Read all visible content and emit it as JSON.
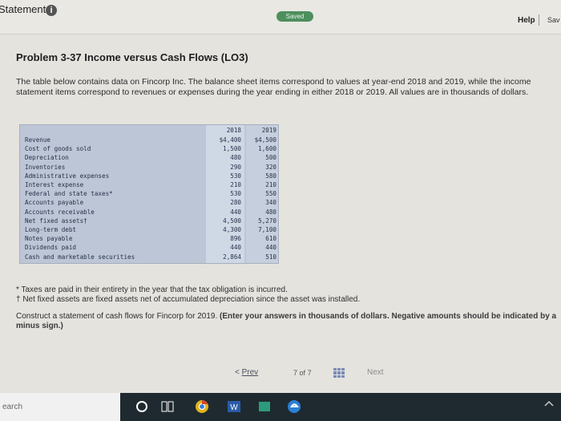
{
  "header": {
    "statement_label": "Statement",
    "info_icon": "i",
    "saved_label": "Saved",
    "help_label": "Help",
    "save_label": "Sav"
  },
  "problem": {
    "title": "Problem 3-37 Income versus Cash Flows (LO3)",
    "intro": "The table below contains data on Fincorp Inc. The balance sheet items correspond to values at year-end 2018 and 2019, while the income statement items correspond to revenues or expenses during the year ending in either 2018 or 2019. All values are in thousands of dollars."
  },
  "table": {
    "year_2018": "2018",
    "year_2019": "2019",
    "rows": [
      {
        "label": "Revenue",
        "v2018": "$4,400",
        "v2019": "$4,500"
      },
      {
        "label": "Cost of goods sold",
        "v2018": "1,500",
        "v2019": "1,600"
      },
      {
        "label": "Depreciation",
        "v2018": "480",
        "v2019": "500"
      },
      {
        "label": "Inventories",
        "v2018": "290",
        "v2019": "320"
      },
      {
        "label": "Administrative expenses",
        "v2018": "530",
        "v2019": "580"
      },
      {
        "label": "Interest expense",
        "v2018": "210",
        "v2019": "210"
      },
      {
        "label": "Federal and state taxes*",
        "v2018": "530",
        "v2019": "550"
      },
      {
        "label": "Accounts payable",
        "v2018": "280",
        "v2019": "340"
      },
      {
        "label": "Accounts receivable",
        "v2018": "440",
        "v2019": "480"
      },
      {
        "label": "Net fixed assets†",
        "v2018": "4,500",
        "v2019": "5,270"
      },
      {
        "label": "Long-term debt",
        "v2018": "4,300",
        "v2019": "7,100"
      },
      {
        "label": "Notes payable",
        "v2018": "896",
        "v2019": "610"
      },
      {
        "label": "Dividends paid",
        "v2018": "440",
        "v2019": "440"
      },
      {
        "label": "Cash and marketable securities",
        "v2018": "2,864",
        "v2019": "510"
      }
    ]
  },
  "footnotes": {
    "taxes": "* Taxes are paid in their entirety in the year that the tax obligation is incurred.",
    "fixed_assets": "† Net fixed assets are fixed assets net of accumulated depreciation since the asset was installed."
  },
  "instructions": {
    "text": "Construct a statement of cash flows for Fincorp for 2019.",
    "bold": "(Enter your answers in thousands of dollars. Negative amounts should be indicated by a minus sign.)"
  },
  "pager": {
    "prev_arrow": "<",
    "prev_label": "Prev",
    "page_current": "7",
    "page_of": "of",
    "page_total": "7",
    "next_label": "Next"
  },
  "taskbar": {
    "search_text": "earch"
  },
  "colors": {
    "table_bg": "#bcc6d6",
    "saved_badge": "#4e8f5e",
    "taskbar": "#1f2a30"
  }
}
